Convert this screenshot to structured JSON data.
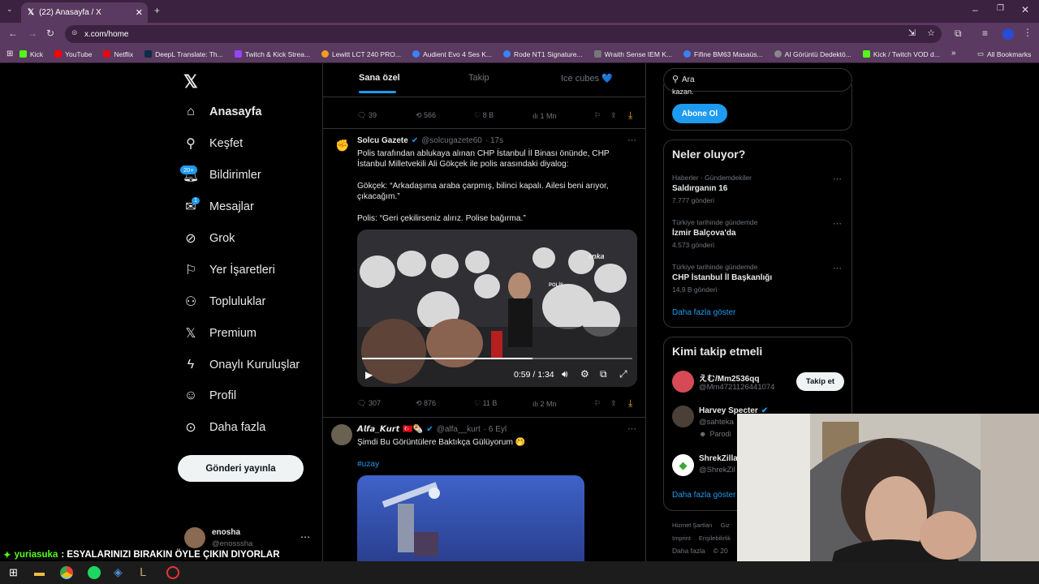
{
  "browser": {
    "tab_title": "(22) Anasayfa / X",
    "url": "x.com/home",
    "bookmarks": [
      "Kick",
      "YouTube",
      "Netflix",
      "DeepL Translate: Th...",
      "Twitch & Kick Strea...",
      "Lewitt LCT 240 PRO...",
      "Audient Evo 4 Ses K...",
      "Rode NT1 Signature...",
      "Wraith Sense IEM K...",
      "Fifine BM63 Masaüs...",
      "AI Görüntü Dedektö...",
      "Kick / Twitch VOD d..."
    ],
    "all_bookmarks": "All Bookmarks"
  },
  "nav": {
    "items": [
      "Anasayfa",
      "Keşfet",
      "Bildirimler",
      "Mesajlar",
      "Grok",
      "Yer İşaretleri",
      "Topluluklar",
      "Premium",
      "Onaylı Kuruluşlar",
      "Profil",
      "Daha fazla"
    ],
    "notif_badge": "20+",
    "msg_badge": "1",
    "post_button": "Gönderi yayınla",
    "account_name": "enosha",
    "account_handle": "@enosssha"
  },
  "timeline": {
    "tabs": [
      "Sana özel",
      "Takip",
      "Ice cubes 💙"
    ],
    "prev_stats": {
      "replies": "39",
      "reposts": "566",
      "likes": "8 B",
      "views": "1 Mn"
    },
    "tweet1": {
      "name": "Solcu Gazete",
      "handle": "@solcugazete60",
      "time": "· 17s",
      "line1": "Polis tarafından ablukaya alınan CHP İstanbul İl Binası önünde, CHP",
      "line2": "İstanbul Milletvekili Ali Gökçek ile polis arasındaki diyalog:",
      "line3": "Gökçek: “Arkadaşıma araba çarpmış, bilinci kapalı. Ailesi beni arıyor,",
      "line4": "çıkacağım.”",
      "line5": "Polis: “Geri çekilirseniz alırız. Polise bağırma.”",
      "video_time": "0:59 / 1:34",
      "video_progress": 0.63,
      "watermark": "anka",
      "police_label": "POLİS",
      "stats": {
        "replies": "307",
        "reposts": "876",
        "likes": "11 B",
        "views": "2 Mn"
      }
    },
    "tweet2": {
      "name": "𝘼𝙡𝙛𝙖_𝙆𝙪𝙧𝙩",
      "flags": "🇹🇷🌯",
      "handle": "@alfa__kurt",
      "time": "· 6 Eyl",
      "text": "Şimdi Bu Görüntülere Baktıkça Gülüyorum 🤭",
      "hashtag": "#uzay"
    }
  },
  "right": {
    "search_placeholder": "Ara",
    "premium_tail": "kazan.",
    "subscribe": "Abone Ol",
    "trends_title": "Neler oluyor?",
    "trends": [
      {
        "cat": "Haberler · Gündemdekiler",
        "title": "Saldırganın 16",
        "count": "7.777 gönderi"
      },
      {
        "cat": "Türkiye tarihinde gündemde",
        "title": "İzmir Balçova'da",
        "count": "4.573 gönderi"
      },
      {
        "cat": "Türkiye tarihinde gündemde",
        "title": "CHP İstanbul İl Başkanlığı",
        "count": "14,9 B gönderi"
      }
    ],
    "show_more": "Daha fazla göster",
    "who_title": "Kimi takip etmeli",
    "who": [
      {
        "name": "えむ/Mm2536qq",
        "handle": "@Mm4721126441074",
        "button": "Takip et"
      },
      {
        "name": "Harvey Specter",
        "handle": "@sahteka",
        "sub": "Parodi"
      },
      {
        "name": "ShrekZilla",
        "handle": "@ShrekZil"
      }
    ],
    "who_more": "Daha fazla göster",
    "footer1": "Hizmet Şartları",
    "footer1b": "Giz",
    "footer2": "Imprint",
    "footer2b": "Erişilebilirlik",
    "footer3": "Daha fazla",
    "footer3b": "© 20"
  },
  "chat": {
    "user": "yuriasuka",
    "message": ": ESYALARINIZI BIRAKIN ÖYLE ÇIKIN DIYORLAR"
  },
  "colors": {
    "accent": "#1d9bf0",
    "chrome": "#5a3a60",
    "bg": "#000000"
  }
}
